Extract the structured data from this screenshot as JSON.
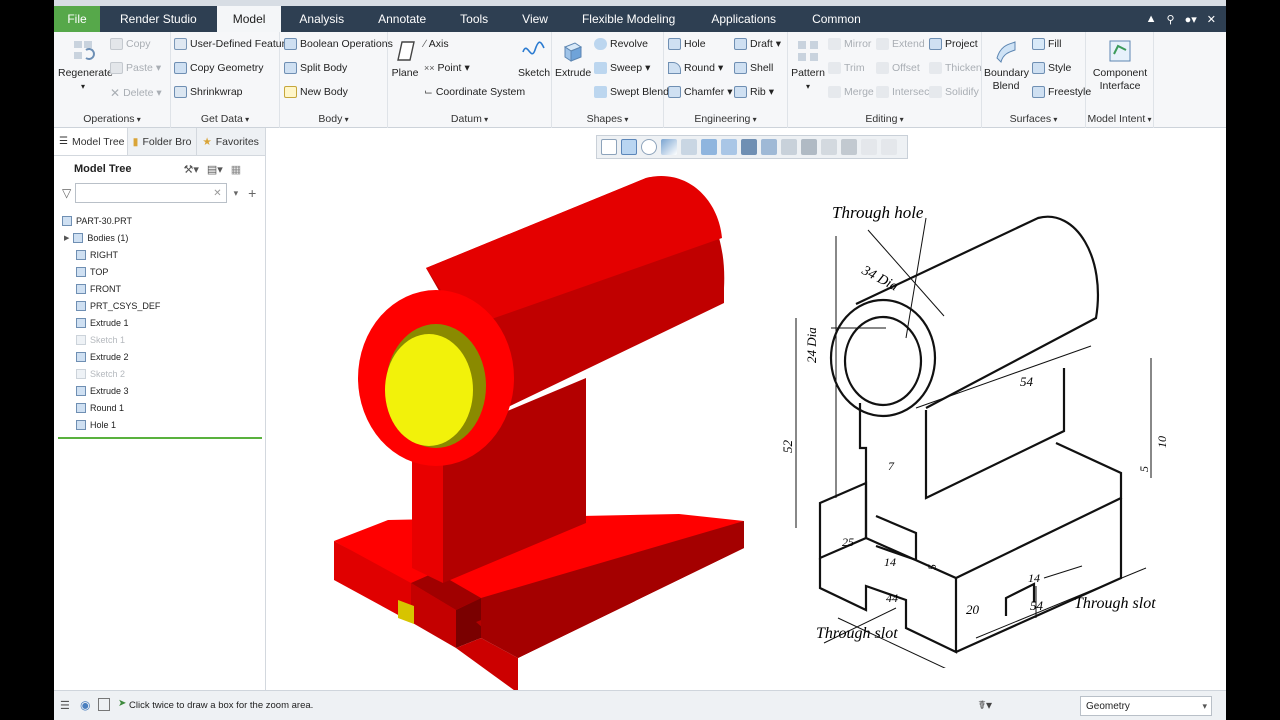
{
  "tabs": [
    {
      "label": "File",
      "kind": "file"
    },
    {
      "label": "Render Studio",
      "kind": "normal"
    },
    {
      "label": "Model",
      "kind": "active"
    },
    {
      "label": "Analysis",
      "kind": "normal"
    },
    {
      "label": "Annotate",
      "kind": "normal"
    },
    {
      "label": "Tools",
      "kind": "normal"
    },
    {
      "label": "View",
      "kind": "normal"
    },
    {
      "label": "Flexible Modeling",
      "kind": "normal"
    },
    {
      "label": "Applications",
      "kind": "normal"
    },
    {
      "label": "Common",
      "kind": "normal"
    }
  ],
  "ribbon": {
    "operations": {
      "label": "Operations",
      "regenerate": "Regenerate",
      "copy": "Copy",
      "paste": "Paste",
      "delete": "Delete"
    },
    "get_data": {
      "label": "Get Data",
      "udf": "User-Defined Feature",
      "copy_geometry": "Copy Geometry",
      "shrinkwrap": "Shrinkwrap"
    },
    "body": {
      "label": "Body",
      "boolean": "Boolean Operations",
      "split": "Split Body",
      "new": "New Body"
    },
    "datum": {
      "label": "Datum",
      "plane": "Plane",
      "axis": "Axis",
      "point": "Point",
      "csys": "Coordinate System",
      "sketch": "Sketch"
    },
    "shapes": {
      "label": "Shapes",
      "extrude": "Extrude",
      "revolve": "Revolve",
      "sweep": "Sweep",
      "swept_blend": "Swept Blend"
    },
    "engineering": {
      "label": "Engineering",
      "hole": "Hole",
      "round": "Round",
      "chamfer": "Chamfer",
      "draft": "Draft",
      "shell": "Shell",
      "rib": "Rib"
    },
    "editing": {
      "label": "Editing",
      "pattern": "Pattern",
      "mirror": "Mirror",
      "trim": "Trim",
      "merge": "Merge",
      "extend": "Extend",
      "offset": "Offset",
      "intersect": "Intersect",
      "project": "Project",
      "thicken": "Thicken",
      "solidify": "Solidify"
    },
    "surfaces": {
      "label": "Surfaces",
      "boundary_blend_1": "Boundary",
      "boundary_blend_2": "Blend",
      "fill": "Fill",
      "style": "Style",
      "freestyle": "Freestyle"
    },
    "model_intent": {
      "label": "Model Intent",
      "component_interface_1": "Component",
      "component_interface_2": "Interface"
    }
  },
  "left_panel": {
    "tabs": [
      "Model Tree",
      "Folder Bro",
      "Favorites"
    ],
    "header": "Model Tree",
    "filter_placeholder": "",
    "items": [
      {
        "label": "PART-30.PRT",
        "indent": 0,
        "disabled": false,
        "icon": "part-icon"
      },
      {
        "label": "Bodies (1)",
        "indent": 1,
        "disabled": false,
        "icon": "bodies-icon"
      },
      {
        "label": "RIGHT",
        "indent": 1,
        "disabled": false,
        "icon": "datum-plane-icon"
      },
      {
        "label": "TOP",
        "indent": 1,
        "disabled": false,
        "icon": "datum-plane-icon"
      },
      {
        "label": "FRONT",
        "indent": 1,
        "disabled": false,
        "icon": "datum-plane-icon"
      },
      {
        "label": "PRT_CSYS_DEF",
        "indent": 1,
        "disabled": false,
        "icon": "csys-icon"
      },
      {
        "label": "Extrude 1",
        "indent": 1,
        "disabled": false,
        "icon": "extrude-icon"
      },
      {
        "label": "Sketch 1",
        "indent": 1,
        "disabled": true,
        "icon": "sketch-icon"
      },
      {
        "label": "Extrude 2",
        "indent": 1,
        "disabled": false,
        "icon": "extrude-icon"
      },
      {
        "label": "Sketch 2",
        "indent": 1,
        "disabled": true,
        "icon": "sketch-icon"
      },
      {
        "label": "Extrude 3",
        "indent": 1,
        "disabled": false,
        "icon": "extrude-icon"
      },
      {
        "label": "Round 1",
        "indent": 1,
        "disabled": false,
        "icon": "round-icon"
      },
      {
        "label": "Hole 1",
        "indent": 1,
        "disabled": false,
        "icon": "hole-icon"
      }
    ]
  },
  "drawing": {
    "through_hole": "Through hole",
    "dia_34": "34 Dia",
    "dia_24": "24 Dia",
    "dim_52": "52",
    "dim_54_top": "54",
    "dim_7": "7",
    "dim_10": "10",
    "dim_5_right": "5",
    "dim_25": "25",
    "dim_14_left": "14",
    "dim_5_mid": "5",
    "dim_44": "44",
    "dim_20": "20",
    "dim_54_bottom": "54",
    "dim_14_right": "14",
    "through_slot_right": "Through slot",
    "through_slot_left": "Through slot"
  },
  "status": {
    "message": "Click twice to draw a box for the zoom area.",
    "selection_filter": "Geometry"
  },
  "colors": {
    "model_red": "#ff0000",
    "model_dark_red": "#b80000",
    "hole_yellow": "#f2f20a",
    "tab_bar": "#2e3f52",
    "file_tab": "#56a84a"
  }
}
